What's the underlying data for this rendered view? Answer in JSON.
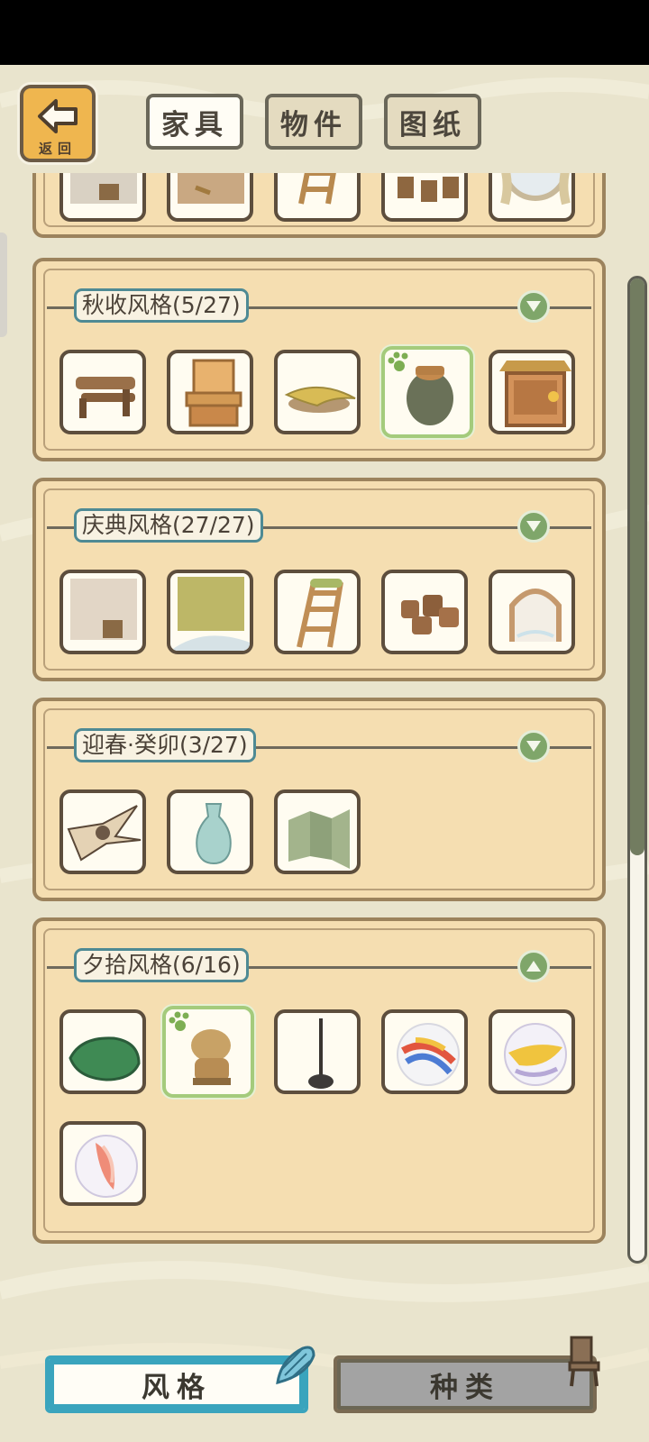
{
  "header": {
    "back_label": "返回",
    "tabs": [
      {
        "label": "家具",
        "active": true
      },
      {
        "label": "物件",
        "active": false
      },
      {
        "label": "图纸",
        "active": false
      }
    ]
  },
  "sections": [
    {
      "title": "",
      "state": "partial",
      "items": [
        "wood-wall-bucket",
        "sand-floor-fish",
        "wooden-ladder",
        "wooden-stools",
        "round-window-curtains"
      ]
    },
    {
      "title": "秋收风格(5/27)",
      "state": "collapsed",
      "items": [
        "wooden-bench",
        "wooden-cupboard",
        "straw-mat",
        "clay-jar",
        "thatched-stall"
      ],
      "selected_index": 3
    },
    {
      "title": "庆典风格(27/27)",
      "state": "collapsed",
      "items": [
        "wood-wall-bucket",
        "green-floor",
        "mossy-ladder",
        "clay-pots",
        "arched-window"
      ]
    },
    {
      "title": "迎春·癸卯(3/27)",
      "state": "collapsed",
      "items": [
        "swallow-kite",
        "celadon-vase",
        "folding-screen"
      ]
    },
    {
      "title": "夕拾风格(6/16)",
      "state": "expanded",
      "items": [
        "green-stone",
        "frog-statue",
        "stick-pole",
        "marble-rainbow",
        "marble-yellow",
        "marble-pink"
      ],
      "selected_index": 1
    }
  ],
  "footer": {
    "style_label": "风格",
    "kind_label": "种类"
  },
  "colors": {
    "background": "#e9e4cd",
    "panel": "#f5deb1",
    "accent_teal": "#3aa4bd",
    "accent_green": "#7fa66a"
  }
}
